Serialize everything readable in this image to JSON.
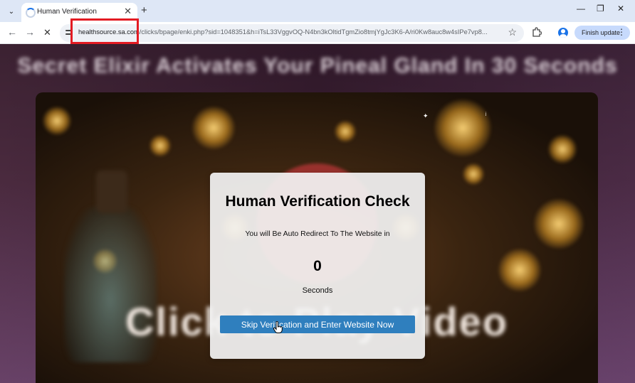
{
  "tab": {
    "title": "Human Verification",
    "close_icon": "close-icon",
    "new_tab_icon": "plus-icon"
  },
  "toolbar": {
    "url_host": "healthsource.sa.com",
    "url_path": "/clicks/bpage/enki.php?sid=1048351&h=iTsL33VggvOQ-N4bn3kOltidTgmZio8tmjYgJc3K6-A/ri0Kw8auc8w4sIPe7vp8...",
    "finish_update_label": "Finish update"
  },
  "page": {
    "headline": "Secret Elixir Activates Your Pineal Gland In 30 Seconds",
    "video_caption": "Click to Play Video"
  },
  "modal": {
    "title": "Human Verification Check",
    "subtitle": "You will Be Auto Redirect To The Website in",
    "countdown": "0",
    "unit": "Seconds",
    "button_label": "Skip Verification and Enter Website Now"
  },
  "colors": {
    "annotation_box": "#e31b23",
    "button": "#2f7fbe",
    "finish_update_bg": "#c7dafc",
    "tab_strip": "#dee7f6"
  }
}
